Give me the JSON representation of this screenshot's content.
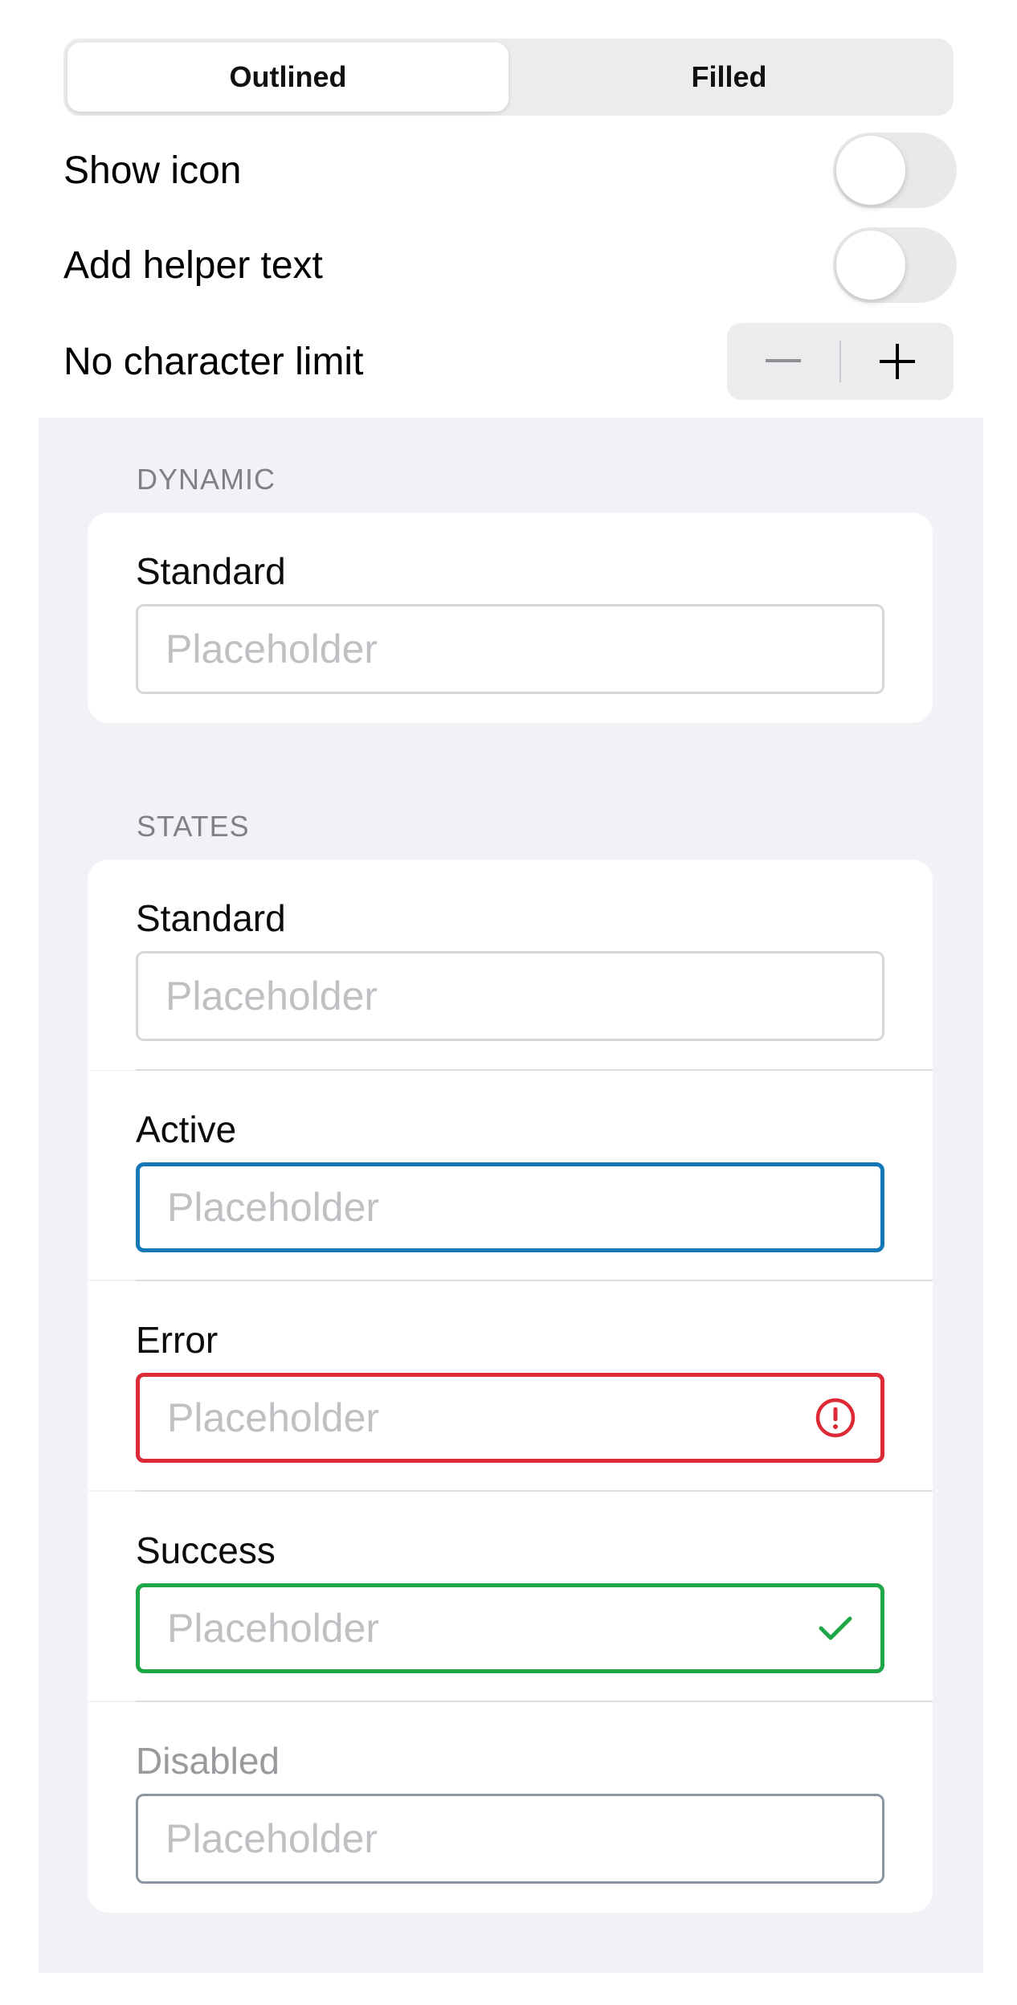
{
  "segmented": {
    "options": [
      "Outlined",
      "Filled"
    ],
    "selected": "Outlined"
  },
  "settings": {
    "show_icon": {
      "label": "Show icon",
      "on": false
    },
    "helper_text": {
      "label": "Add helper text",
      "on": false
    },
    "char_limit": {
      "label": "No character limit",
      "decrement_icon": "minus-icon",
      "increment_icon": "plus-icon"
    }
  },
  "sections": {
    "dynamic": {
      "header": "DYNAMIC",
      "fields": [
        {
          "label": "Standard",
          "placeholder": "Placeholder",
          "state": "standard"
        }
      ]
    },
    "states": {
      "header": "STATES",
      "fields": [
        {
          "label": "Standard",
          "placeholder": "Placeholder",
          "state": "standard"
        },
        {
          "label": "Active",
          "placeholder": "Placeholder",
          "state": "active"
        },
        {
          "label": "Error",
          "placeholder": "Placeholder",
          "state": "error",
          "icon": "error-circle-icon"
        },
        {
          "label": "Success",
          "placeholder": "Placeholder",
          "state": "success",
          "icon": "checkmark-icon"
        },
        {
          "label": "Disabled",
          "placeholder": "Placeholder",
          "state": "disabled"
        }
      ]
    }
  },
  "colors": {
    "active": "#1478b8",
    "error": "#dc2a36",
    "success": "#1ea747",
    "disabled_border": "#8a97a3",
    "grouped_background": "#f2f2f6"
  }
}
